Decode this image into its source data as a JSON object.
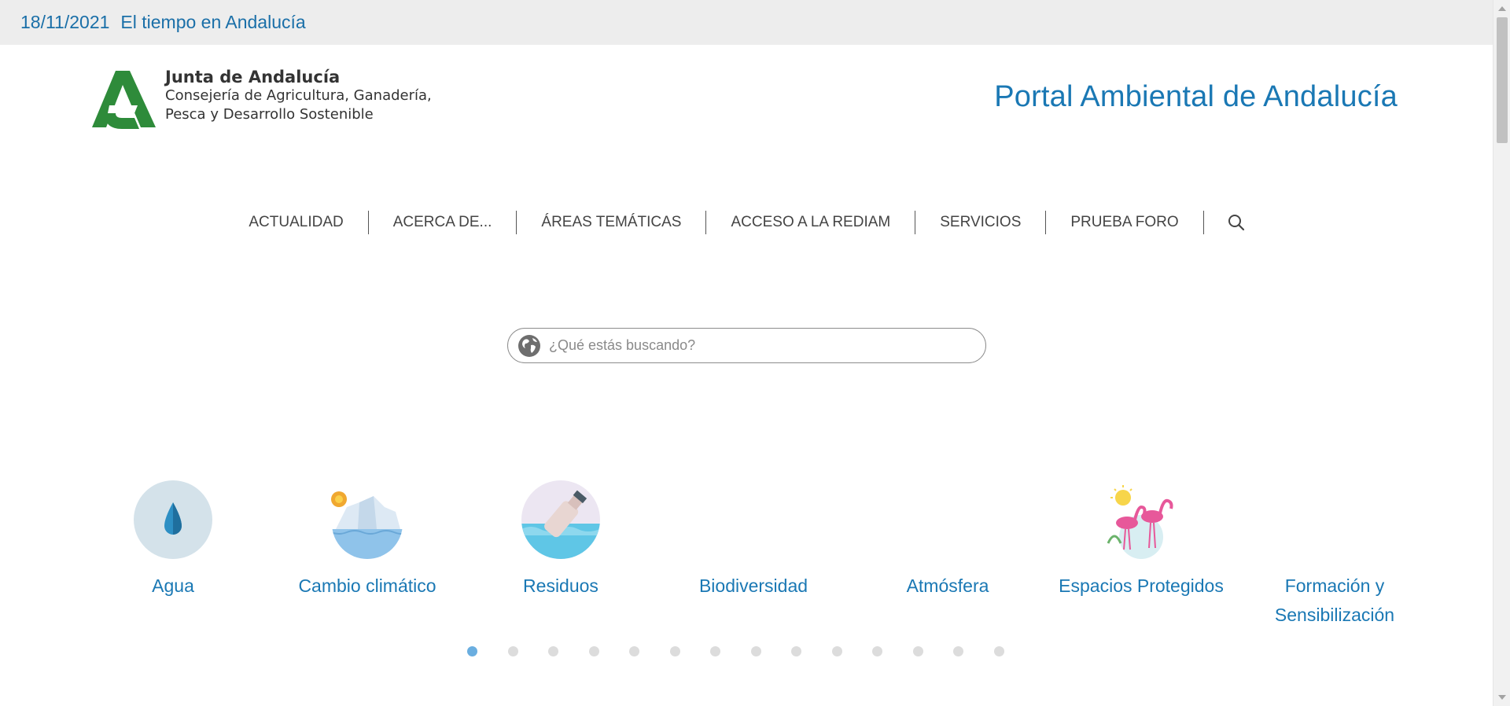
{
  "topbar": {
    "date": "18/11/2021",
    "weather_link": "El tiempo en Andalucía"
  },
  "header": {
    "logo_title": "Junta de Andalucía",
    "logo_subtitle_1": "Consejería de Agricultura, Ganadería,",
    "logo_subtitle_2": "Pesca y Desarrollo Sostenible",
    "portal_title": "Portal Ambiental de Andalucía"
  },
  "nav": {
    "items": [
      {
        "label": "ACTUALIDAD"
      },
      {
        "label": "ACERCA DE..."
      },
      {
        "label": "ÁREAS TEMÁTICAS"
      },
      {
        "label": "ACCESO A LA REDIAM"
      },
      {
        "label": "SERVICIOS"
      },
      {
        "label": "PRUEBA FORO"
      }
    ],
    "search_icon": "search-icon"
  },
  "search": {
    "placeholder": "¿Qué estás buscando?",
    "icon": "globe-icon"
  },
  "themes": [
    {
      "label": "Agua",
      "icon": "water-drop-icon"
    },
    {
      "label": "Cambio climático",
      "icon": "climate-change-icon"
    },
    {
      "label": "Residuos",
      "icon": "waste-bottle-icon"
    },
    {
      "label": "Biodiversidad",
      "icon": ""
    },
    {
      "label": "Atmósfera",
      "icon": ""
    },
    {
      "label": "Espacios Protegidos",
      "icon": "flamingo-icon"
    },
    {
      "label": "Formación y Sensibilización",
      "icon": ""
    }
  ],
  "carousel": {
    "dot_count": 14,
    "active_index": 0
  },
  "colors": {
    "accent": "#1a78b4",
    "topbar_bg": "#ededed",
    "logo_green": "#2e8b3a",
    "dot_active": "#6aaee0",
    "dot_inactive": "#dcdcdc"
  }
}
